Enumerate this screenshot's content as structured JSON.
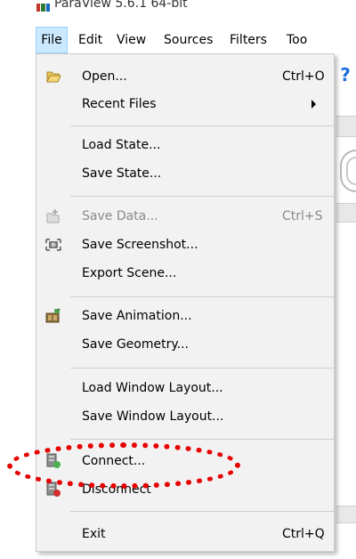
{
  "window": {
    "title": "ParaView 5.6.1 64-bit"
  },
  "menubar": {
    "items": [
      "File",
      "Edit",
      "View",
      "Sources",
      "Filters",
      "Too"
    ]
  },
  "file_menu": {
    "open": {
      "label": "Open...",
      "shortcut": "Ctrl+O"
    },
    "recent_files": {
      "label": "Recent Files"
    },
    "load_state": {
      "label": "Load State..."
    },
    "save_state": {
      "label": "Save State..."
    },
    "save_data": {
      "label": "Save Data...",
      "shortcut": "Ctrl+S"
    },
    "save_screenshot": {
      "label": "Save Screenshot..."
    },
    "export_scene": {
      "label": "Export Scene..."
    },
    "save_animation": {
      "label": "Save Animation..."
    },
    "save_geometry": {
      "label": "Save Geometry..."
    },
    "load_window_layout": {
      "label": "Load Window Layout..."
    },
    "save_window_layout": {
      "label": "Save Window Layout..."
    },
    "connect": {
      "label": "Connect..."
    },
    "disconnect": {
      "label": "Disconnect"
    },
    "exit": {
      "label": "Exit",
      "shortcut": "Ctrl+Q"
    }
  },
  "background": {
    "help_glyph": "?"
  },
  "colors": {
    "menu_active_bg": "#cce8ff",
    "menu_bg": "#f2f2f2",
    "disabled_text": "#8a8a8a",
    "annotation_red": "#e60000"
  },
  "icons": {
    "open": "folder-open-icon",
    "save_data": "save-data-icon",
    "save_screenshot": "camera-icon",
    "save_animation": "film-icon",
    "connect": "server-connect-icon",
    "disconnect": "server-disconnect-icon"
  }
}
